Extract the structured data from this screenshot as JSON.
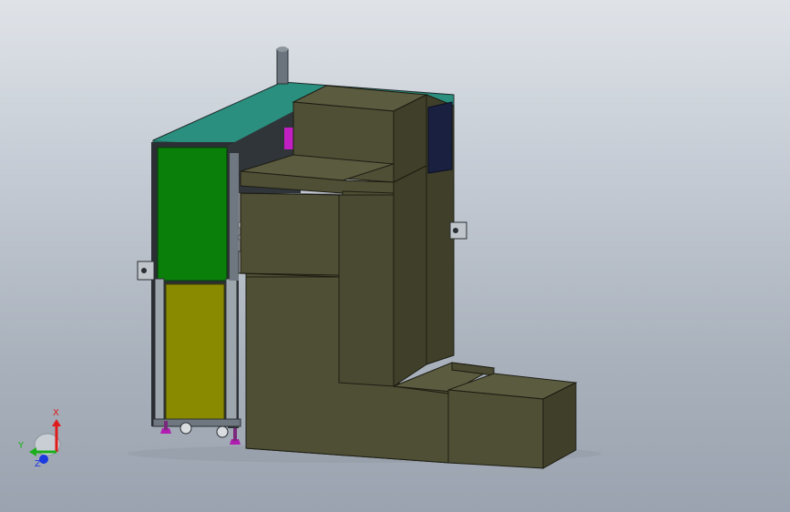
{
  "scene": {
    "description_hidden": "",
    "triad": {
      "x_label": "X",
      "y_label": "Y",
      "z_label": "Z"
    }
  },
  "colors": {
    "background_top": "#dfe3e8",
    "background_bottom": "#9aa3af",
    "olive_body": "#4f4f36",
    "olive_side": "#3f3f2a",
    "olive_top": "#5b5b40",
    "teal_top": "#2a8f7e",
    "green_door": "#0a7f0a",
    "yellow_door": "#8a8a00",
    "frame_dark": "#2b2f33",
    "frame_light": "#9ea6ad",
    "magenta_part": "#c21fc2",
    "navy_panel": "#1a2040",
    "axis_x": "#e01b1b",
    "axis_y": "#1bb01b",
    "axis_z": "#1b3ae0"
  }
}
